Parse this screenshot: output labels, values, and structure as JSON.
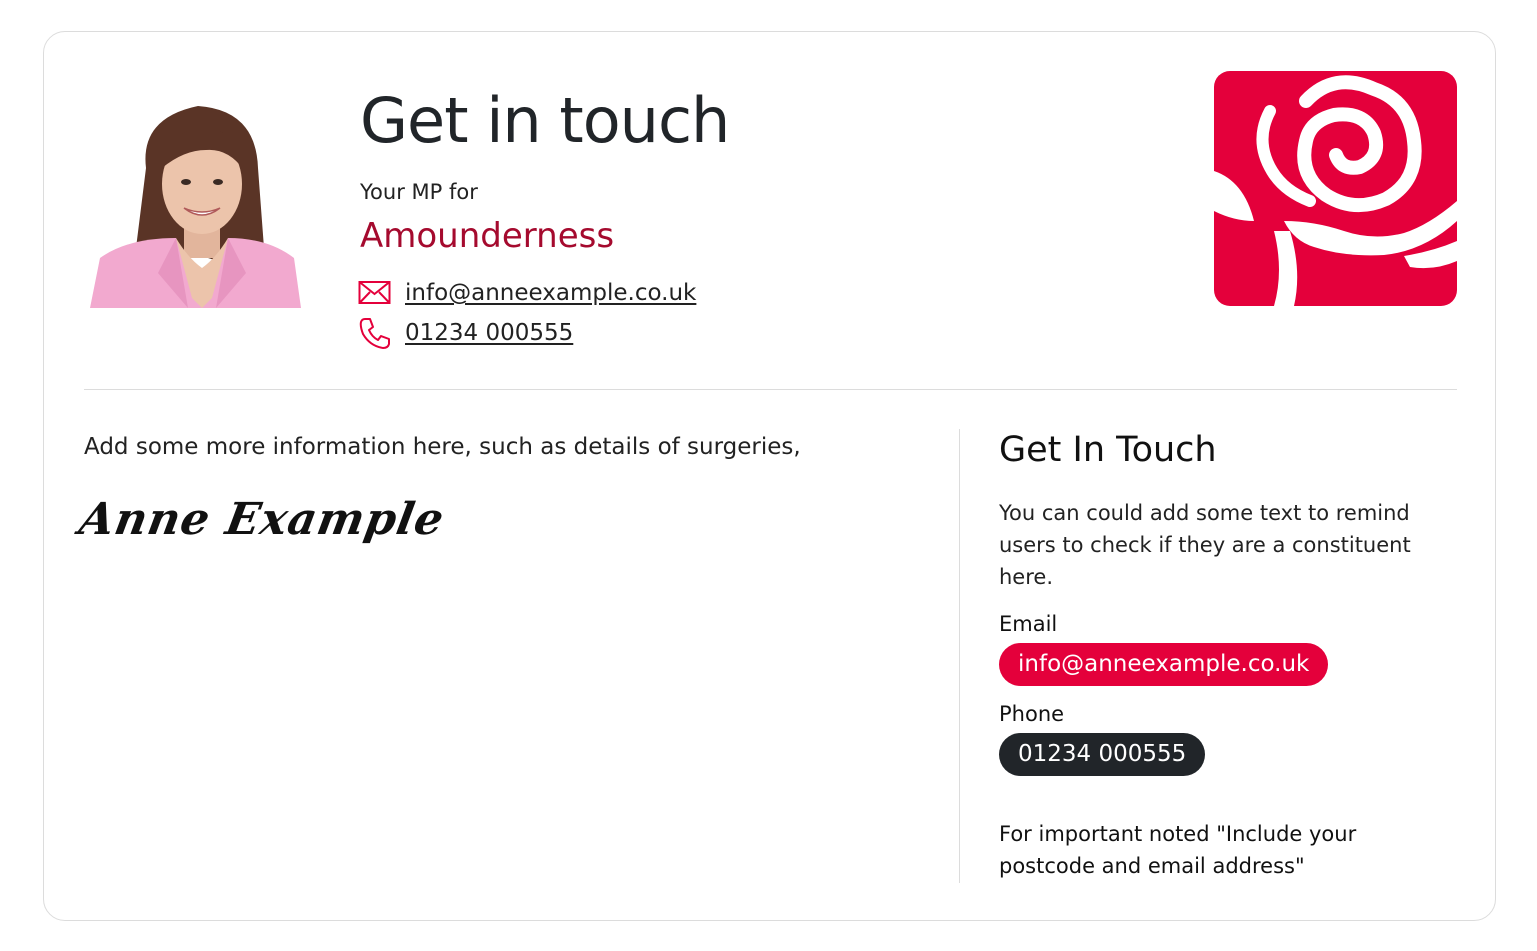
{
  "header": {
    "title": "Get in touch",
    "subtitle": "Your MP for",
    "constituency": "Amounderness",
    "email": "info@anneexample.co.uk",
    "phone": "01234 000555"
  },
  "body": {
    "info_text": "Add some more information here, such as details of surgeries,",
    "signature": "Anne Example"
  },
  "sidebar": {
    "title": "Get In Touch",
    "text": "You can could add some text to remind users to check if they are a constituent here.",
    "email_label": "Email",
    "email": "info@anneexample.co.uk",
    "phone_label": "Phone",
    "phone": "01234 000555",
    "note": "For important noted \"Include your postcode and email address\""
  },
  "colors": {
    "accent": "#e4003b",
    "constituency": "#a50a2e",
    "dark": "#212529"
  },
  "icons": {
    "email": "envelope-icon",
    "phone": "phone-icon",
    "logo": "rose-logo-icon"
  }
}
